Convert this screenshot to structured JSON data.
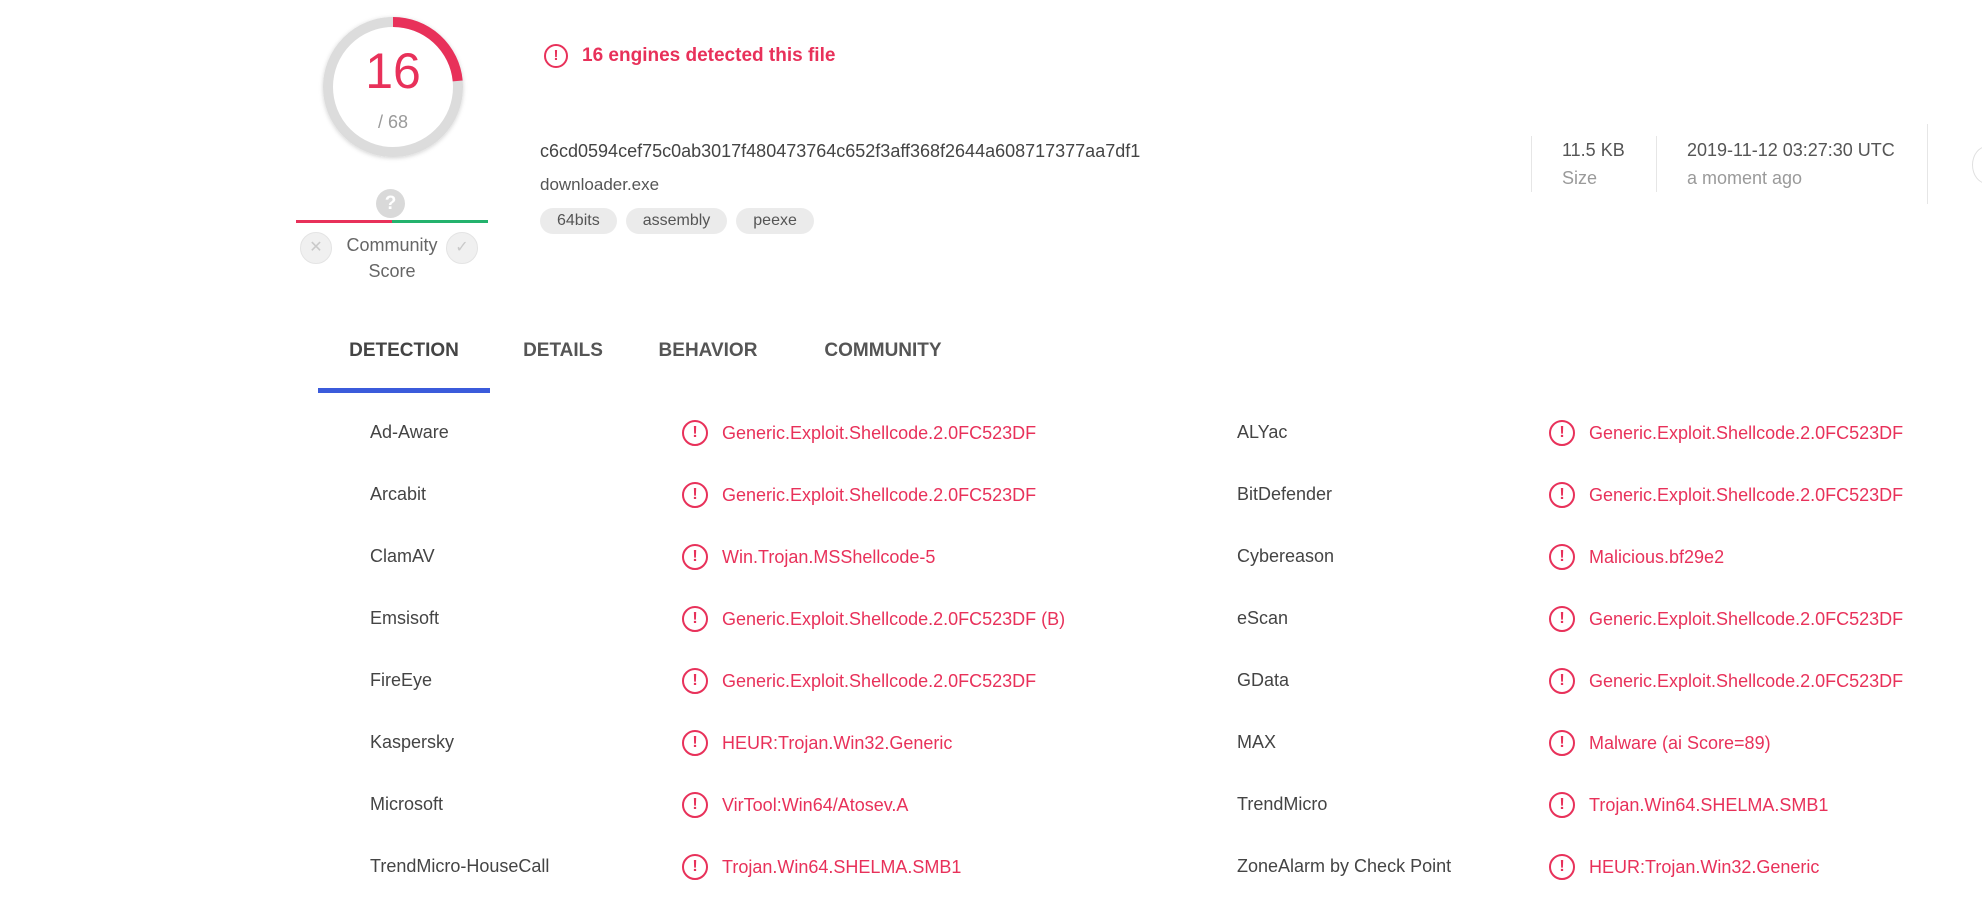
{
  "score": {
    "detected": "16",
    "total": "/ 68",
    "fraction": 0.235
  },
  "community": {
    "unknown_glyph": "?",
    "label_line1": "Community",
    "label_line2": "Score",
    "down_icon": "x-icon",
    "up_icon": "check-icon"
  },
  "summary": {
    "alert": "16 engines detected this file",
    "hash": "c6cd0594cef75c0ab3017f480473764c652f3aff368f2644a608717377aa7df1",
    "filename": "downloader.exe",
    "tags": [
      "64bits",
      "assembly",
      "peexe"
    ],
    "size_value": "11.5 KB",
    "size_label": "Size",
    "date_value": "2019-11-12 03:27:30 UTC",
    "date_label": "a moment ago"
  },
  "tabs": [
    {
      "label": "DETECTION"
    },
    {
      "label": "DETAILS"
    },
    {
      "label": "BEHAVIOR"
    },
    {
      "label": "COMMUNITY"
    }
  ],
  "detections": [
    [
      {
        "engine": "Ad-Aware",
        "result": "Generic.Exploit.Shellcode.2.0FC523DF"
      },
      {
        "engine": "ALYac",
        "result": "Generic.Exploit.Shellcode.2.0FC523DF"
      }
    ],
    [
      {
        "engine": "Arcabit",
        "result": "Generic.Exploit.Shellcode.2.0FC523DF"
      },
      {
        "engine": "BitDefender",
        "result": "Generic.Exploit.Shellcode.2.0FC523DF"
      }
    ],
    [
      {
        "engine": "ClamAV",
        "result": "Win.Trojan.MSShellcode-5"
      },
      {
        "engine": "Cybereason",
        "result": "Malicious.bf29e2"
      }
    ],
    [
      {
        "engine": "Emsisoft",
        "result": "Generic.Exploit.Shellcode.2.0FC523DF (B)"
      },
      {
        "engine": "eScan",
        "result": "Generic.Exploit.Shellcode.2.0FC523DF"
      }
    ],
    [
      {
        "engine": "FireEye",
        "result": "Generic.Exploit.Shellcode.2.0FC523DF"
      },
      {
        "engine": "GData",
        "result": "Generic.Exploit.Shellcode.2.0FC523DF"
      }
    ],
    [
      {
        "engine": "Kaspersky",
        "result": "HEUR:Trojan.Win32.Generic"
      },
      {
        "engine": "MAX",
        "result": "Malware (ai Score=89)"
      }
    ],
    [
      {
        "engine": "Microsoft",
        "result": "VirTool:Win64/Atosev.A"
      },
      {
        "engine": "TrendMicro",
        "result": "Trojan.Win64.SHELMA.SMB1"
      }
    ],
    [
      {
        "engine": "TrendMicro-HouseCall",
        "result": "Trojan.Win64.SHELMA.SMB1"
      },
      {
        "engine": "ZoneAlarm by Check Point",
        "result": "HEUR:Trojan.Win32.Generic"
      }
    ]
  ],
  "colors": {
    "malicious": "#e8315a",
    "accent": "#3b5bdb",
    "harmless": "#23b26d"
  },
  "icons": {
    "detection": "exclamation-circle-icon"
  }
}
